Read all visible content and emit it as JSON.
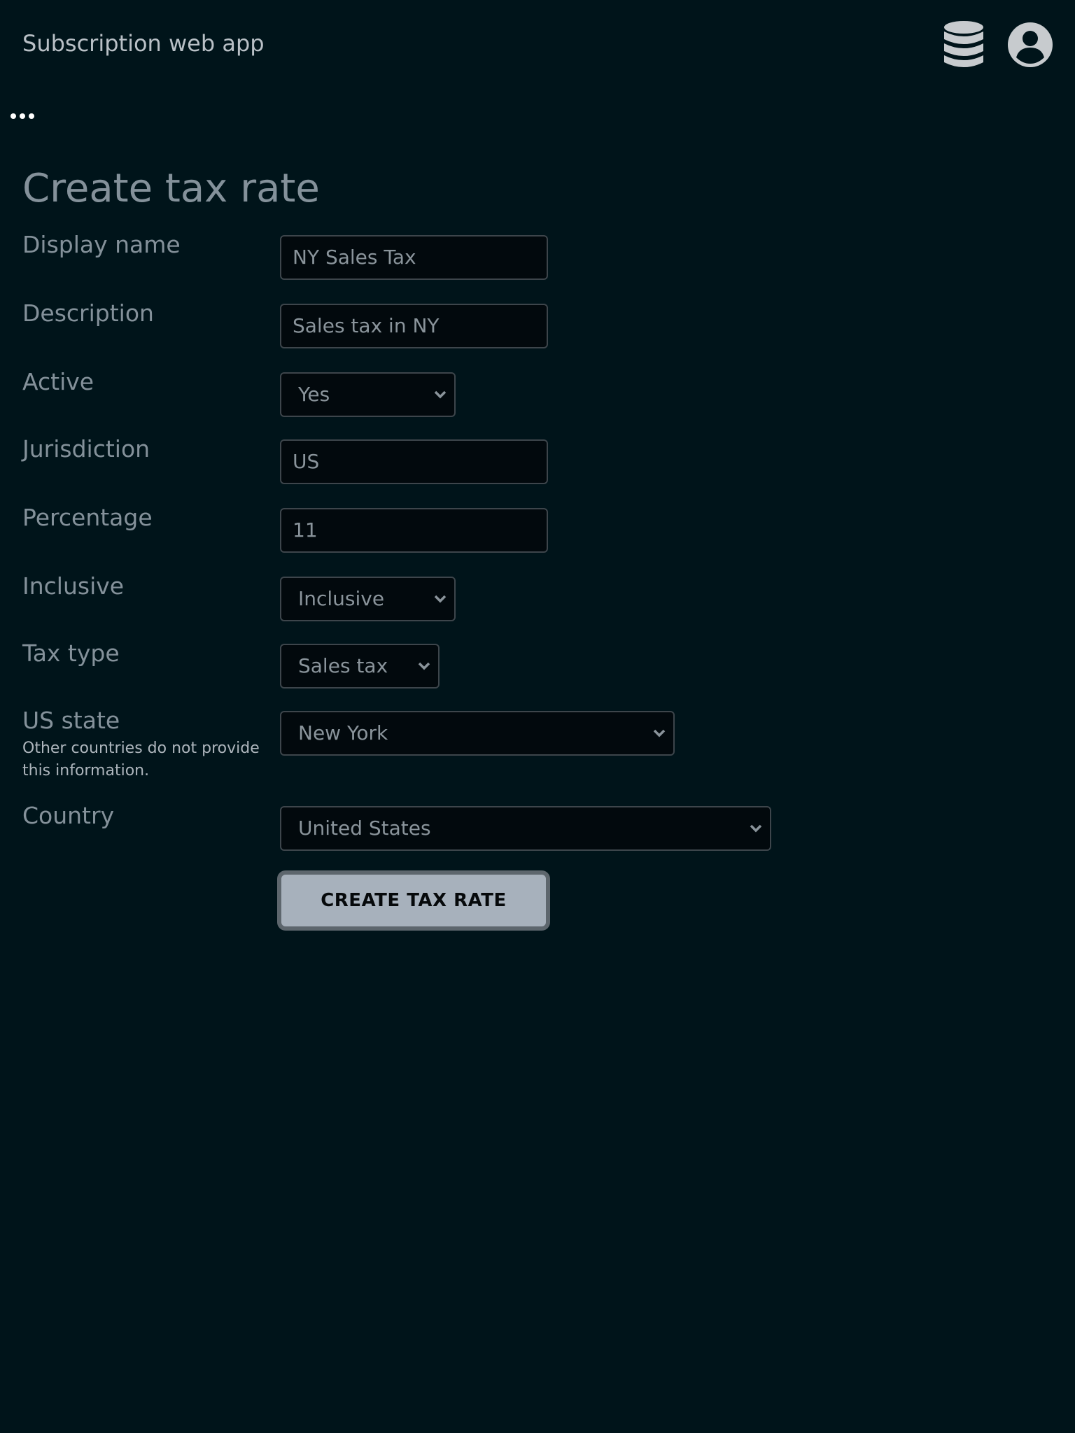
{
  "header": {
    "app_title": "Subscription web app",
    "database_icon": "database-icon",
    "account_icon": "account-circle-icon"
  },
  "nav": {
    "more_icon": "more-horizontal-icon"
  },
  "page": {
    "title": "Create tax rate"
  },
  "form": {
    "display_name": {
      "label": "Display name",
      "value": "NY Sales Tax"
    },
    "description": {
      "label": "Description",
      "value": "Sales tax in NY"
    },
    "active": {
      "label": "Active",
      "value": "Yes"
    },
    "jurisdiction": {
      "label": "Jurisdiction",
      "value": "US"
    },
    "percentage": {
      "label": "Percentage",
      "value": "11"
    },
    "inclusive": {
      "label": "Inclusive",
      "value": "Inclusive"
    },
    "tax_type": {
      "label": "Tax type",
      "value": "Sales tax"
    },
    "us_state": {
      "label": "US state",
      "help": "Other countries do not provide this information.",
      "value": "New York"
    },
    "country": {
      "label": "Country",
      "value": "United States"
    },
    "submit_label": "CREATE TAX RATE"
  },
  "colors": {
    "background": "#00141a",
    "label": "#84919a",
    "input_background": "#02090d",
    "input_border": "#3d454b",
    "button_background": "#a7b1bc",
    "button_border": "#5d666d",
    "icon": "#c7cbce"
  }
}
